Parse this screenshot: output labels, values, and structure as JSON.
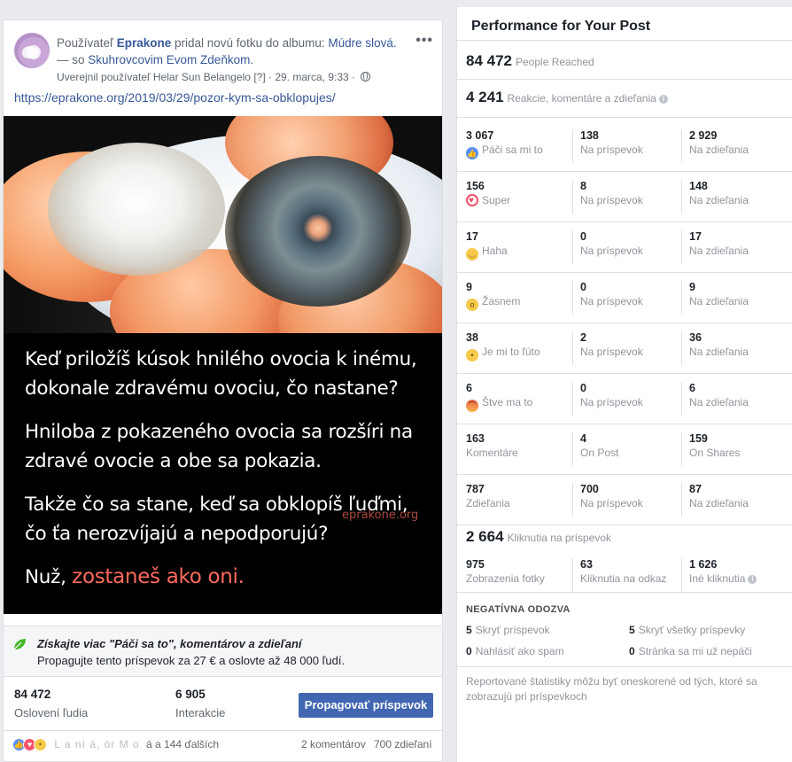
{
  "post": {
    "header_prefix": "Používateľ ",
    "page_name": "Eprakone",
    "header_mid": " pridal novú fotku do albumu: ",
    "album_name": "Múdre slová.",
    "with_text": " — so ",
    "tagged_name": "Skuhrovcovim Evom Zdeňkom.",
    "published_by": "Uverejnil používateľ Helar Sun Belangelo",
    "help_marker": "[?]",
    "date": "29. marca, 9:33",
    "link": "https://eprakone.org/2019/03/29/pozor-kym-sa-obklopujes/",
    "photo_text": {
      "p1": "Keď priložíš kúsok hnilého ovocia k inému, dokonale zdravému ovociu, čo nastane?",
      "p2": "Hniloba z pokazeného ovocia sa rozšíri na zdravé ovocie a obe sa pokazia.",
      "p3": "Takže čo sa stane, keď sa obklopíš ľuďmi, čo ťa nerozvíjajú a nepodporujú?",
      "p4_prefix": "Nuž, ",
      "p4_accent": "zostaneš ako oni.",
      "watermark": "eprakone.org"
    },
    "promo": {
      "title": "Získajte viac \"Páči sa to\", komentárov a zdieľaní",
      "subtitle": "Propagujte tento príspevok za 27 € a oslovte až 48 000 ľudí."
    },
    "reached": {
      "value": "84 472",
      "label": "Oslovení ľudia"
    },
    "interactions": {
      "value": "6 905",
      "label": "Interakcie"
    },
    "boost_label": "Propagovať príspevok",
    "reactions_bar": {
      "names": "L     a       ní       á,      ór     M         o",
      "others": "á a 144 ďalších",
      "comments": "2 komentárov",
      "shares": "700 zdieľaní"
    }
  },
  "panel": {
    "title": "Performance for Your Post",
    "people_reached": {
      "value": "84 472",
      "label": "People Reached"
    },
    "reactions_total": {
      "value": "4 241",
      "label": "Reakcie, komentáre a zdieľania"
    },
    "rows": [
      {
        "icon": "like-icon",
        "c1": {
          "v": "3 067",
          "l": "Páči sa mi to"
        },
        "c2": {
          "v": "138",
          "l": "Na príspevok"
        },
        "c3": {
          "v": "2 929",
          "l": "Na zdieľania"
        }
      },
      {
        "icon": "love-icon",
        "c1": {
          "v": "156",
          "l": "Super"
        },
        "c2": {
          "v": "8",
          "l": "Na príspevok"
        },
        "c3": {
          "v": "148",
          "l": "Na zdieľania"
        }
      },
      {
        "icon": "haha-icon",
        "c1": {
          "v": "17",
          "l": "Haha"
        },
        "c2": {
          "v": "0",
          "l": "Na príspevok"
        },
        "c3": {
          "v": "17",
          "l": "Na zdieľania"
        }
      },
      {
        "icon": "wow-icon",
        "c1": {
          "v": "9",
          "l": "Žasnem"
        },
        "c2": {
          "v": "0",
          "l": "Na príspevok"
        },
        "c3": {
          "v": "9",
          "l": "Na zdieľania"
        }
      },
      {
        "icon": "sad-icon",
        "c1": {
          "v": "38",
          "l": "Je mi to ľúto"
        },
        "c2": {
          "v": "2",
          "l": "Na príspevok"
        },
        "c3": {
          "v": "36",
          "l": "Na zdieľania"
        }
      },
      {
        "icon": "angry-icon",
        "c1": {
          "v": "6",
          "l": "Štve ma to"
        },
        "c2": {
          "v": "0",
          "l": "Na príspevok"
        },
        "c3": {
          "v": "6",
          "l": "Na zdieľania"
        }
      },
      {
        "icon": "",
        "c1": {
          "v": "163",
          "l": "Komentáre"
        },
        "c2": {
          "v": "4",
          "l": "On Post"
        },
        "c3": {
          "v": "159",
          "l": "On Shares"
        }
      },
      {
        "icon": "",
        "c1": {
          "v": "787",
          "l": "Zdieľania"
        },
        "c2": {
          "v": "700",
          "l": "Na príspevok"
        },
        "c3": {
          "v": "87",
          "l": "Na zdieľania"
        }
      }
    ],
    "clicks_total": {
      "value": "2 664",
      "label": "Kliknutia na príspevok"
    },
    "clicks": [
      {
        "v": "975",
        "l": "Zobrazenia fotky"
      },
      {
        "v": "63",
        "l": "Kliknutia na odkaz"
      },
      {
        "v": "1 626",
        "l": "Iné kliknutia"
      }
    ],
    "negative_title": "NEGATÍVNA ODOZVA",
    "negative": [
      {
        "n": "5",
        "l": "Skryť príspevok"
      },
      {
        "n": "5",
        "l": "Skryť všetky príspevky"
      },
      {
        "n": "0",
        "l": "Nahlásiť ako spam"
      },
      {
        "n": "0",
        "l": "Stránka sa mi už nepáči"
      }
    ],
    "footer": "Reportované štatistiky môžu byť oneskorené od tých, ktoré sa zobrazujú pri príspevkoch"
  }
}
